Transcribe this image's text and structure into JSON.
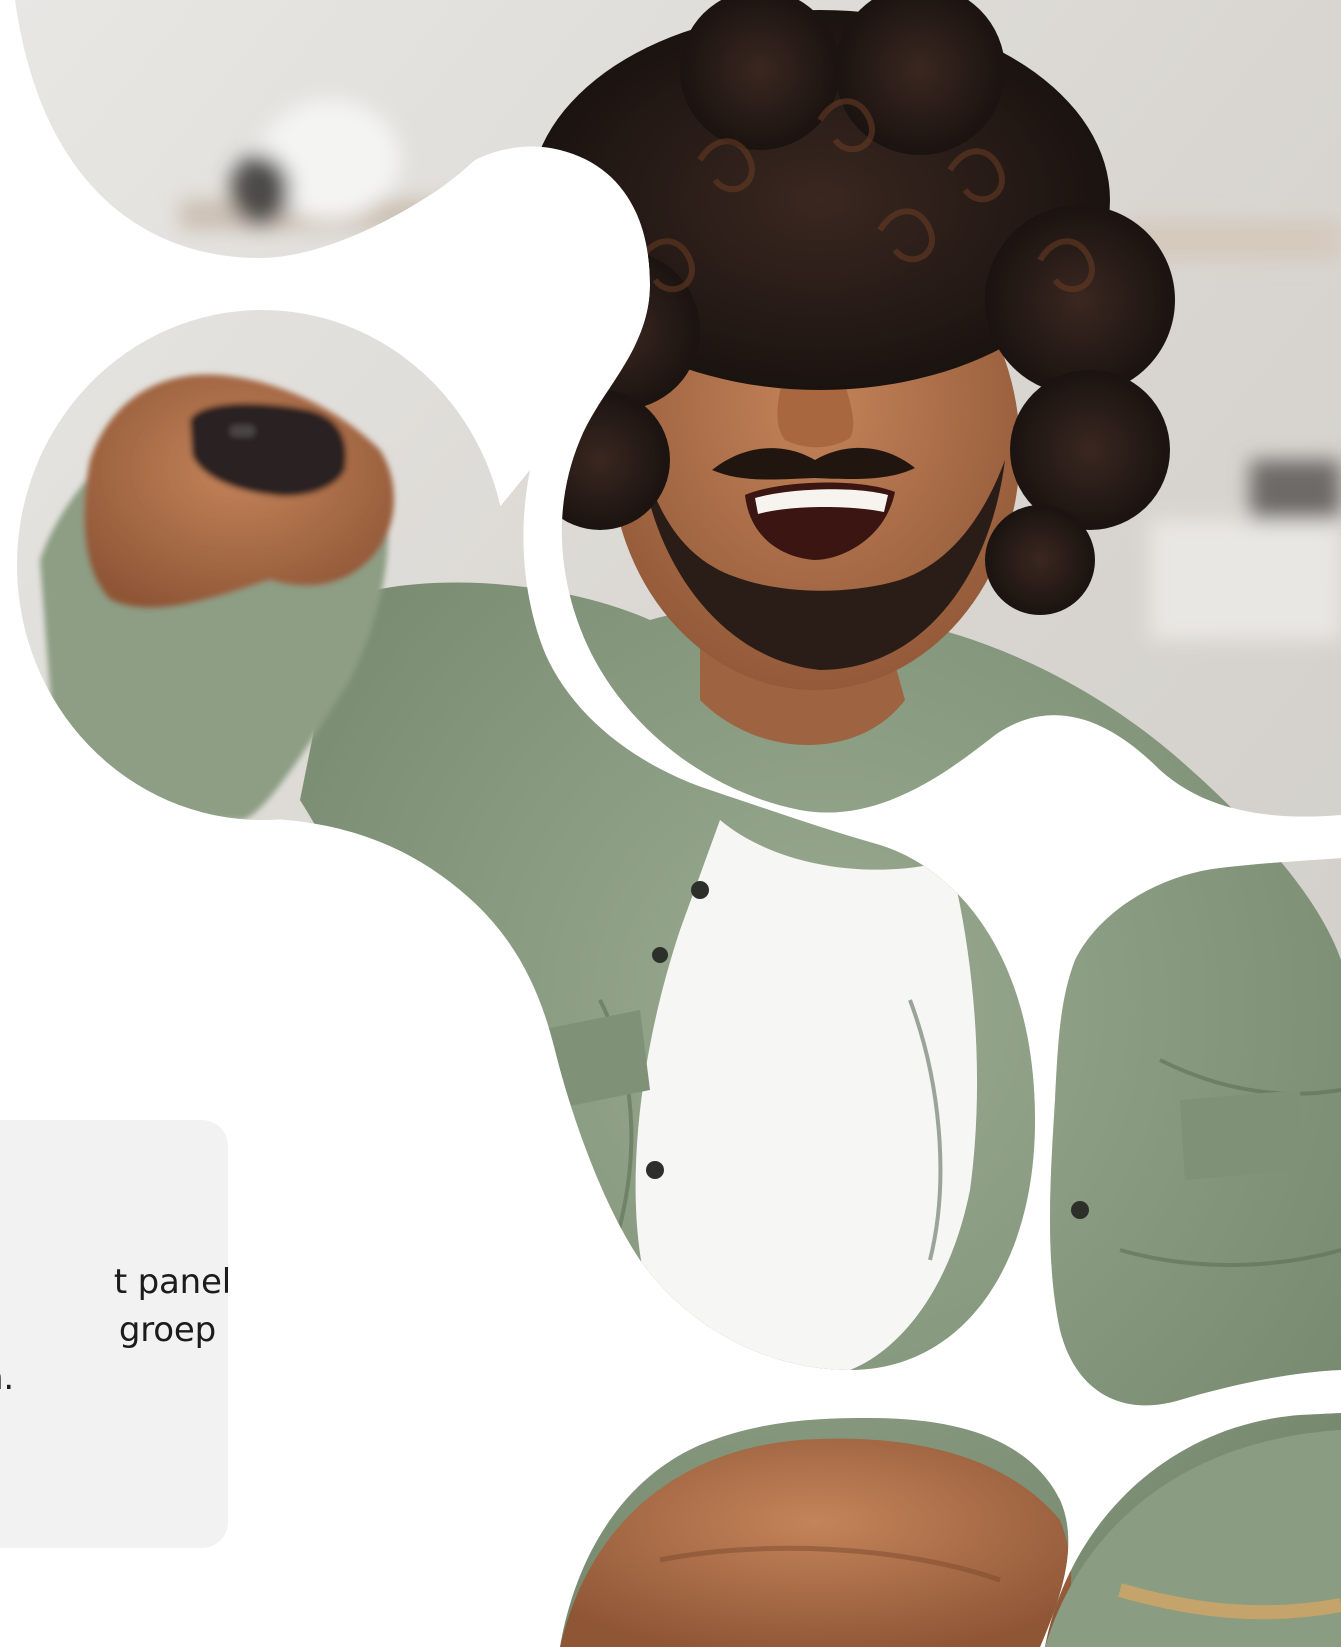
{
  "card": {
    "lines": [
      "t panel",
      "groep",
      "en."
    ]
  },
  "colors": {
    "shirt": "#8c9d84",
    "skin": "#b1744c",
    "hair": "#1e1613",
    "background_blur": "#dcdad6",
    "card_background": "#f2f2f2",
    "text": "#1c1c1c"
  }
}
